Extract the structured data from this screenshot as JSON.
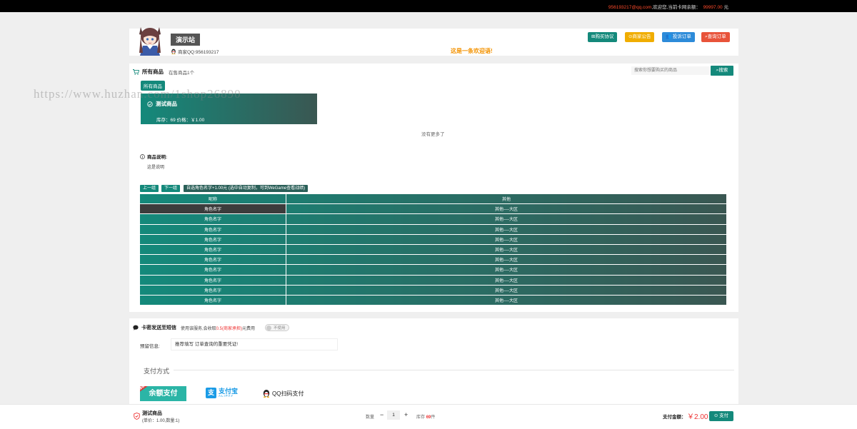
{
  "topbar": {
    "email": "956193217@qq.com",
    "text": ",欢迎您,当前卡网余额：",
    "balance": "99997.00",
    "unit": "元"
  },
  "header": {
    "site_name": "演示站",
    "merchant_qq": "商家QQ:956193217",
    "welcome": "这是一条欢迎语!",
    "buttons": [
      {
        "label": "购买协议",
        "color": "#14897b",
        "icon": "doc-icon"
      },
      {
        "label": "商家公告",
        "color": "#f0ad00",
        "icon": "bell-icon"
      },
      {
        "label": "投诉订单",
        "color": "#2d8bd9",
        "icon": "user-icon"
      },
      {
        "label": "查询订单",
        "color": "#e8533a",
        "icon": "search-icon"
      }
    ]
  },
  "goods": {
    "title": "所有商品",
    "subtitle": "在售商品1个",
    "search_placeholder": "搜索你想要购买的商品",
    "search_button": "搜索",
    "category": "所有商品",
    "product": {
      "name": "测试商品",
      "meta": "库存：69  价格：￥1.00"
    },
    "no_more": "没有更多了",
    "desc_title": "商品说明:",
    "desc_text": "这是说明"
  },
  "table_controls": {
    "prev": "上一组",
    "next": "下一组",
    "auto": "自选角色名字+1.00元 (选中自动复制，可到WeGame查看战绩)"
  },
  "table": {
    "headers": [
      "昵称",
      "其他"
    ],
    "rows": [
      [
        "角色名字",
        "其他----大区"
      ],
      [
        "角色名字",
        "其他----大区"
      ],
      [
        "角色名字",
        "其他----大区"
      ],
      [
        "角色名字",
        "其他----大区"
      ],
      [
        "角色名字",
        "其他----大区"
      ],
      [
        "角色名字",
        "其他----大区"
      ],
      [
        "角色名字",
        "其他----大区"
      ],
      [
        "角色名字",
        "其他----大区"
      ],
      [
        "角色名字",
        "其他----大区"
      ],
      [
        "角色名字",
        "其他----大区"
      ]
    ]
  },
  "sms": {
    "title": "卡密发送至短信",
    "hint_pre": "使用该服务,会收取",
    "hint_red": "0.5(商家承担)",
    "hint_post": "元费用",
    "toggle": "不使用",
    "reserve_label": "预留信息:",
    "reserve_value": "推荐填写  订单查询的重要凭证!"
  },
  "payment": {
    "legend": "支付方式",
    "yu_label": "余额支付",
    "yu_corner": "推荐",
    "ali_label": "支付宝",
    "ali_sub": "ALIPAY",
    "qq_label": "QQ扫码支付"
  },
  "footer": {
    "name": "测试商品",
    "unit_line": "(单价：1.00,数量:1)",
    "qty_label": "数量",
    "minus": "−",
    "qty": "1",
    "plus": "+",
    "stock_label": "库存",
    "stock_num": "69",
    "stock_unit": "件",
    "total_label": "支付金额：",
    "total": "￥2.00",
    "pay_button": "支付"
  },
  "watermark": "https://www.huzhan.com/1shop26890"
}
